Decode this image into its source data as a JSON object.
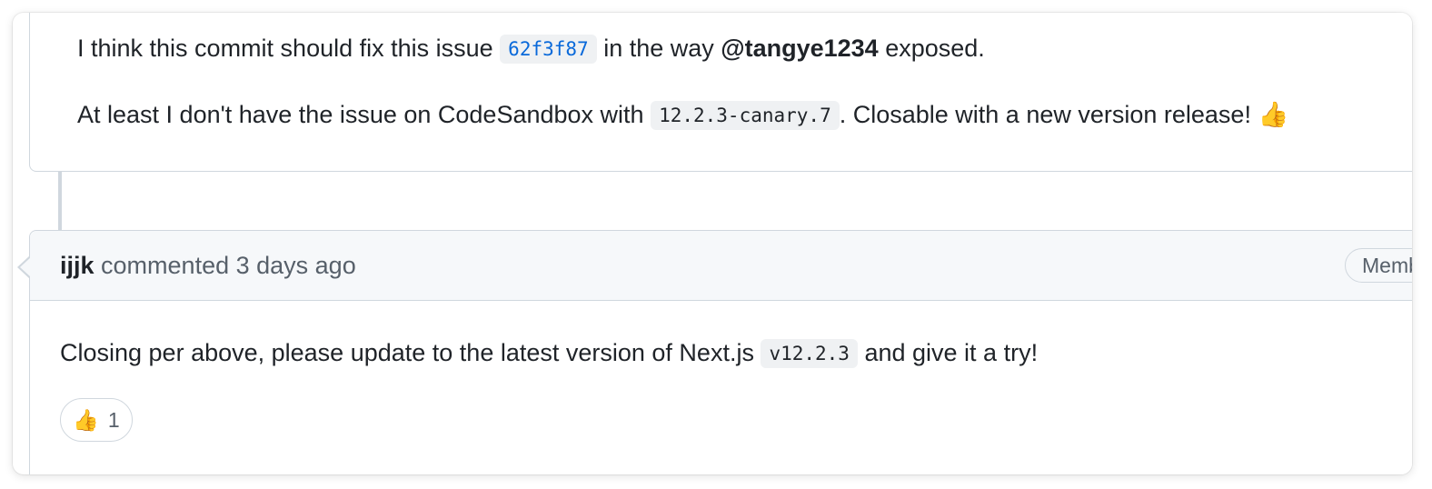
{
  "comment1": {
    "line1_before": "I think this commit should fix this issue ",
    "commit_sha": "62f3f87",
    "line1_mid": " in the way ",
    "mention": "@tangye1234",
    "line1_after": " exposed.",
    "line2_before": "At least I don't have the issue on CodeSandbox with ",
    "version_code": "12.2.3-canary.7",
    "line2_after": ". Closable with a new version release! ",
    "thumbs_emoji": "👍"
  },
  "comment2": {
    "author": "ijjk",
    "action": " commented ",
    "timestamp": "3 days ago",
    "role_badge": "Member",
    "body_before": "Closing per above, please update to the latest version of Next.js ",
    "version_code": "v12.2.3",
    "body_after": " and give it a try!",
    "reaction": {
      "emoji": "👍",
      "count": "1"
    }
  },
  "colors": {
    "link": "#0969da",
    "border": "#d0d7de",
    "header_bg": "#f6f8fa",
    "code_bg": "#eff1f3"
  }
}
